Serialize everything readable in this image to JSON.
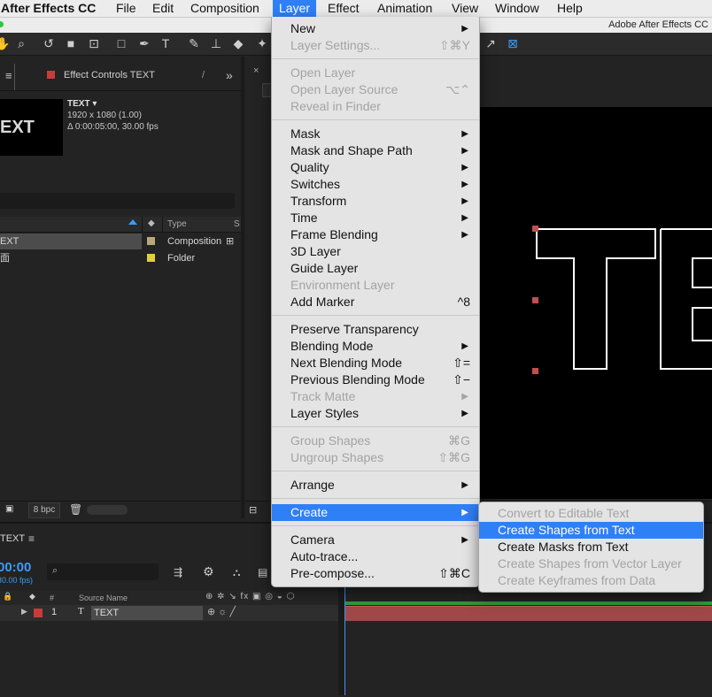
{
  "menubar": {
    "app": "After Effects CC",
    "items": [
      "File",
      "Edit",
      "Composition",
      "Layer",
      "Effect",
      "Animation",
      "View",
      "Window",
      "Help"
    ]
  },
  "titlebar": {
    "title": "Adobe After Effects CC"
  },
  "effect_controls": {
    "tab_label": "Effect Controls TEXT",
    "comp_name": "TEXT ▾",
    "resolution": "1920 x 1080 (1.00)",
    "duration": "Δ 0:00:05:00, 30.00 fps",
    "thumb_text": "EXT"
  },
  "project": {
    "column_type": "Type",
    "column_s": "S",
    "rows": [
      {
        "name": "EXT",
        "type": "Composition",
        "color": "#b8a878"
      },
      {
        "name": "面",
        "type": "Folder",
        "color": "#e0d040"
      }
    ],
    "bpc": "8 bpc"
  },
  "timeline": {
    "comp": "TEXT",
    "time": "00:00",
    "fps": "30.00 fps)",
    "col_num": "#",
    "col_source": "Source Name",
    "layer": {
      "index": "1",
      "name": "TEXT"
    }
  },
  "layer_menu": {
    "items": [
      {
        "label": "New",
        "arrow": true
      },
      {
        "label": "Layer Settings...",
        "shortcut": "⇧⌘Y",
        "disabled": true
      },
      {
        "sep": true
      },
      {
        "label": "Open Layer",
        "disabled": true
      },
      {
        "label": "Open Layer Source",
        "shortcut": "⌥⌃",
        "disabled": true
      },
      {
        "label": "Reveal in Finder",
        "disabled": true
      },
      {
        "sep": true
      },
      {
        "label": "Mask",
        "arrow": true
      },
      {
        "label": "Mask and Shape Path",
        "arrow": true
      },
      {
        "label": "Quality",
        "arrow": true
      },
      {
        "label": "Switches",
        "arrow": true
      },
      {
        "label": "Transform",
        "arrow": true
      },
      {
        "label": "Time",
        "arrow": true
      },
      {
        "label": "Frame Blending",
        "arrow": true
      },
      {
        "label": "3D Layer"
      },
      {
        "label": "Guide Layer"
      },
      {
        "label": "Environment Layer",
        "disabled": true
      },
      {
        "label": "Add Marker",
        "shortcut": "^8"
      },
      {
        "sep": true
      },
      {
        "label": "Preserve Transparency"
      },
      {
        "label": "Blending Mode",
        "arrow": true
      },
      {
        "label": "Next Blending Mode",
        "shortcut": "⇧="
      },
      {
        "label": "Previous Blending Mode",
        "shortcut": "⇧−"
      },
      {
        "label": "Track Matte",
        "arrow": true,
        "disabled": true
      },
      {
        "label": "Layer Styles",
        "arrow": true
      },
      {
        "sep": true
      },
      {
        "label": "Group Shapes",
        "shortcut": "⌘G",
        "disabled": true
      },
      {
        "label": "Ungroup Shapes",
        "shortcut": "⇧⌘G",
        "disabled": true
      },
      {
        "sep": true
      },
      {
        "label": "Arrange",
        "arrow": true
      },
      {
        "sep": true
      },
      {
        "label": "Create",
        "arrow": true,
        "highlight": true
      },
      {
        "sep": true
      },
      {
        "label": "Camera",
        "arrow": true
      },
      {
        "label": "Auto-trace..."
      },
      {
        "label": "Pre-compose...",
        "shortcut": "⇧⌘C"
      }
    ]
  },
  "create_submenu": {
    "items": [
      {
        "label": "Convert to Editable Text",
        "disabled": true
      },
      {
        "label": "Create Shapes from Text",
        "highlight": true
      },
      {
        "label": "Create Masks from Text"
      },
      {
        "label": "Create Shapes from Vector Layer",
        "disabled": true
      },
      {
        "label": "Create Keyframes from Data",
        "disabled": true
      }
    ]
  },
  "colors": {
    "accent": "#2f7ff7",
    "timecode": "#3a9cf5",
    "layer_bar": "#a04848",
    "label_red": "#c93b3b"
  }
}
